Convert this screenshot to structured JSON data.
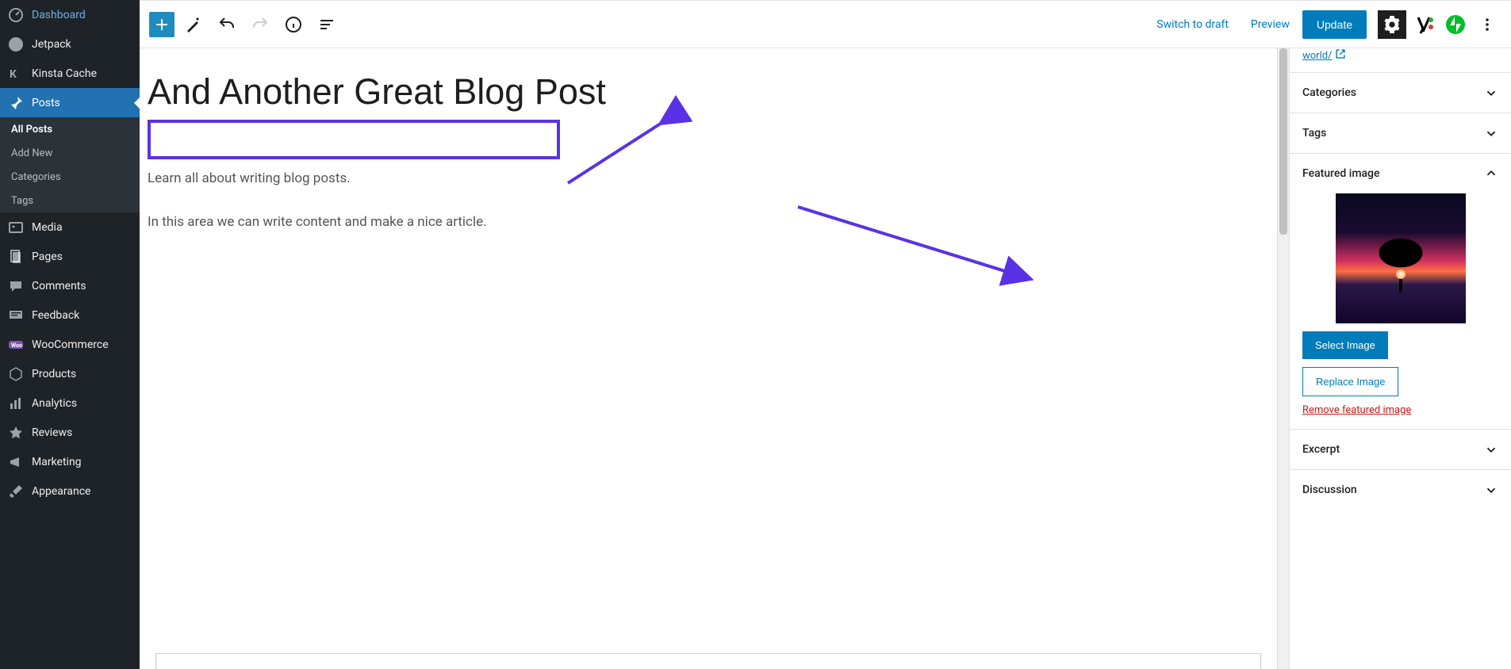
{
  "sidebar": {
    "items": [
      {
        "label": "Dashboard"
      },
      {
        "label": "Jetpack"
      },
      {
        "label": "Kinsta Cache"
      },
      {
        "label": "Posts"
      },
      {
        "label": "Media"
      },
      {
        "label": "Pages"
      },
      {
        "label": "Comments"
      },
      {
        "label": "Feedback"
      },
      {
        "label": "WooCommerce"
      },
      {
        "label": "Products"
      },
      {
        "label": "Analytics"
      },
      {
        "label": "Reviews"
      },
      {
        "label": "Marketing"
      },
      {
        "label": "Appearance"
      }
    ],
    "submenu": {
      "all_posts": "All Posts",
      "add_new": "Add New",
      "categories": "Categories",
      "tags": "Tags"
    }
  },
  "topbar": {
    "switch_to_draft": "Switch to draft",
    "preview": "Preview",
    "update": "Update"
  },
  "post": {
    "title": "And Another Great Blog Post",
    "para1": "Learn all about writing blog posts.",
    "para2": "In this area we can write content and make a nice article."
  },
  "inspector": {
    "url_suffix": "world/",
    "categories": "Categories",
    "tags": "Tags",
    "featured_image": "Featured image",
    "select_image": "Select Image",
    "replace_image": "Replace Image",
    "remove_image": "Remove featured image",
    "excerpt": "Excerpt",
    "discussion": "Discussion"
  }
}
